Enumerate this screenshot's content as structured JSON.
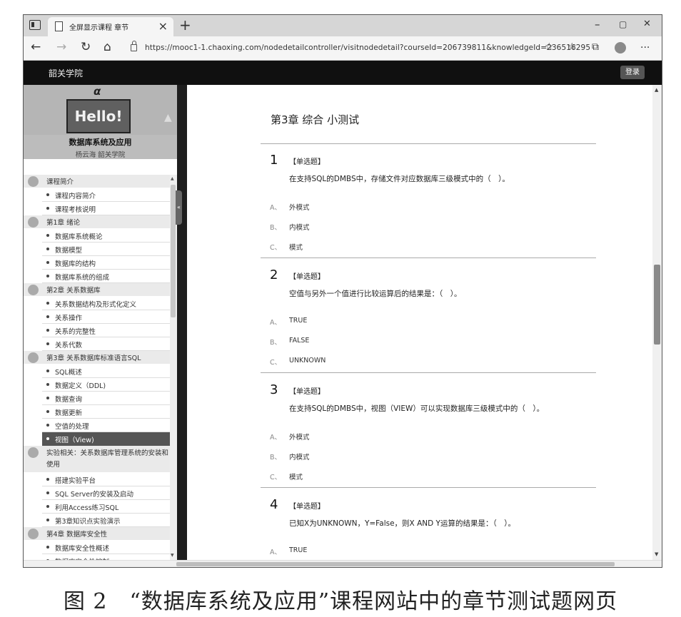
{
  "browser": {
    "tab_title": "全屏显示课程 章节",
    "tab_close_glyph": "×",
    "new_tab_glyph": "+",
    "url": "https://mooc1-1.chaoxing.com/nodedetailcontroller/visitnodedetail?courseId=206739811&knowledgeId=236516295",
    "controls": {
      "minimize": "–",
      "maximize": "▢",
      "close": "✕"
    },
    "nav": {
      "back": "←",
      "forward": "→",
      "refresh": "↻",
      "home": "⌂"
    },
    "tools": {
      "favorite": "☆",
      "favorites_list": "☆",
      "collections": "⧉",
      "menu": "···"
    }
  },
  "site": {
    "name": "韶关学院",
    "login_label": "登录"
  },
  "course": {
    "banner_hello": "Hello!",
    "banner_alpha": "α",
    "title": "数据库系统及应用",
    "teacher": "杨云海 韶关学院",
    "collapse_glyph": "«"
  },
  "sidebar": {
    "chapters": [
      {
        "label": "课程简介",
        "sections": [
          "课程内容简介",
          "课程考核说明"
        ]
      },
      {
        "label": "第1章 绪论",
        "sections": [
          "数据库系统概论",
          "数据模型",
          "数据库的结构",
          "数据库系统的组成"
        ]
      },
      {
        "label": "第2章 关系数据库",
        "sections": [
          "关系数据结构及形式化定义",
          "关系操作",
          "关系的完整性",
          "关系代数"
        ]
      },
      {
        "label": "第3章 关系数据库标准语言SQL",
        "sections": [
          "SQL概述",
          "数据定义（DDL)",
          "数据查询",
          "数据更新",
          "空值的处理",
          "视图（View)"
        ]
      },
      {
        "label": "实验相关：关系数据库管理系统的安装和使用",
        "sections": [
          "搭建实验平台",
          "SQL Server的安装及启动",
          "利用Access练习SQL",
          "第3章知识点实验演示"
        ]
      },
      {
        "label": "第4章 数据库安全性",
        "sections": [
          "数据库安全性概述",
          "数据库安全性控制"
        ]
      }
    ],
    "active_section": "视图（View)"
  },
  "quiz": {
    "title": "第3章 综合 小测试",
    "questions": [
      {
        "number": "1",
        "type": "【单选题】",
        "stem": "在支持SQL的DMBS中，存储文件对应数据库三级模式中的（　）。",
        "options": [
          {
            "letter": "A、",
            "text": "外模式"
          },
          {
            "letter": "B、",
            "text": "内模式"
          },
          {
            "letter": "C、",
            "text": "模式"
          }
        ]
      },
      {
        "number": "2",
        "type": "【单选题】",
        "stem": "空值与另外一个值进行比较运算后的结果是：（　）。",
        "options": [
          {
            "letter": "A、",
            "text": "TRUE"
          },
          {
            "letter": "B、",
            "text": "FALSE"
          },
          {
            "letter": "C、",
            "text": "UNKNOWN"
          }
        ]
      },
      {
        "number": "3",
        "type": "【单选题】",
        "stem": "在支持SQL的DMBS中，视图（VIEW）可以实现数据库三级模式中的（　）。",
        "options": [
          {
            "letter": "A、",
            "text": "外模式"
          },
          {
            "letter": "B、",
            "text": "内模式"
          },
          {
            "letter": "C、",
            "text": "模式"
          }
        ]
      },
      {
        "number": "4",
        "type": "【单选题】",
        "stem": "已知X为UNKNOWN，Y=False，则X AND Y运算的结果是：（　）。",
        "options": [
          {
            "letter": "A、",
            "text": "TRUE"
          }
        ]
      }
    ]
  },
  "caption": "图 2　“数据库系统及应用”课程网站中的章节测试题网页"
}
